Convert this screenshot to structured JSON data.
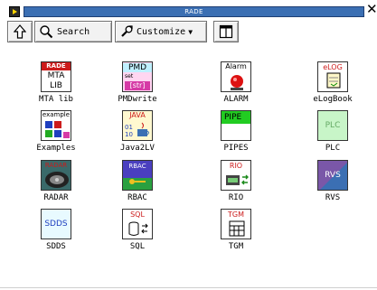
{
  "window": {
    "title": "RADE"
  },
  "toolbar": {
    "search_label": "Search",
    "customize_label": "Customize"
  },
  "apps": [
    {
      "label": "MTA lib",
      "badge": "RADE",
      "lines": [
        "MTA",
        "LIB"
      ]
    },
    {
      "label": "PMDwrite",
      "badge": "PMD",
      "sub": [
        "set",
        "[str]"
      ]
    },
    {
      "label": "ALARM",
      "badge": "Alarm"
    },
    {
      "label": "eLogBook",
      "badge": "eLOG"
    },
    {
      "label": "Examples",
      "badge": "example"
    },
    {
      "label": "Java2LV",
      "badge": "JAVA",
      "sub": [
        "01",
        "10"
      ]
    },
    {
      "label": "PIPES",
      "badge": "PIPE"
    },
    {
      "label": "PLC",
      "badge": "PLC"
    },
    {
      "label": "RADAR",
      "badge": "RADAR"
    },
    {
      "label": "RBAC",
      "badge": "RBAC"
    },
    {
      "label": "RIO",
      "badge": "RIO"
    },
    {
      "label": "RVS",
      "badge": "RVS"
    },
    {
      "label": "SDDS",
      "badge": "SDDS"
    },
    {
      "label": "SQL",
      "badge": "SQL"
    },
    {
      "label": "TGM",
      "badge": "TGM"
    }
  ],
  "colors": {
    "title_bar": "#3b6fb3",
    "rade_red": "#cc1b1b",
    "pmd_magenta": "#d63aa6",
    "pipe_green": "#22cc22",
    "plc_green": "#c8f5c8",
    "rvs_purple": "#7a57a8"
  }
}
